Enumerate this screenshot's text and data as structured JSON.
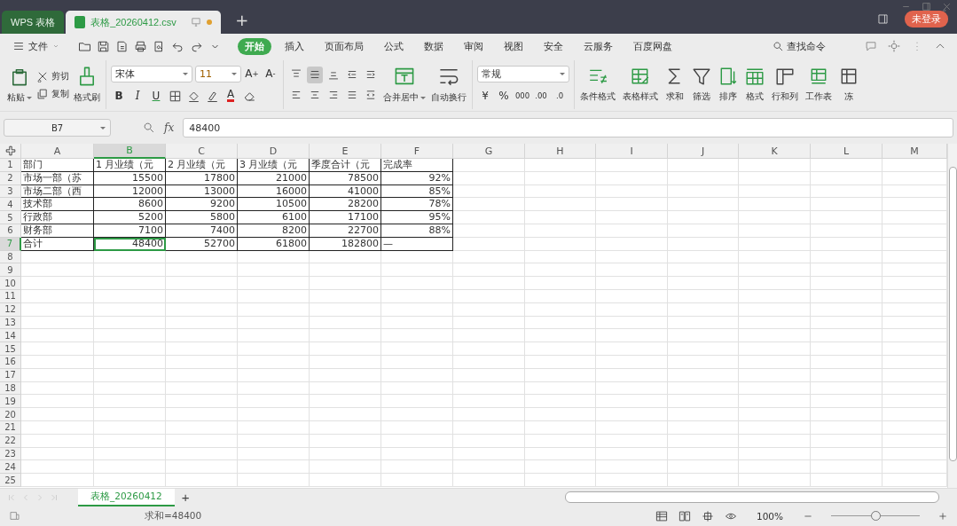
{
  "title_bar": {
    "tabs": [
      {
        "label": "WPS 表格",
        "kind": "home",
        "selected": false,
        "unsaved": false
      },
      {
        "label": "表格_20260412.csv",
        "kind": "file",
        "selected": true,
        "unsaved": true
      }
    ],
    "new_tab": "+",
    "login": "未登录"
  },
  "menu_bar": {
    "file": "文件",
    "tabs": [
      {
        "label": "开始",
        "selected": true
      },
      {
        "label": "插入",
        "selected": false
      },
      {
        "label": "页面布局",
        "selected": false
      },
      {
        "label": "公式",
        "selected": false
      },
      {
        "label": "数据",
        "selected": false
      },
      {
        "label": "审阅",
        "selected": false
      },
      {
        "label": "视图",
        "selected": false
      },
      {
        "label": "安全",
        "selected": false
      },
      {
        "label": "云服务",
        "selected": false
      },
      {
        "label": "百度网盘",
        "selected": false
      }
    ],
    "search": "查找命令"
  },
  "ribbon": {
    "clipboard": {
      "paste": "粘贴",
      "cut": "剪切",
      "copy": "复制",
      "format_painter": "格式刷"
    },
    "font": {
      "family": "宋体",
      "size": "11",
      "grow": "A",
      "grow_mark": "+",
      "shrink": "A",
      "shrink_mark": "-",
      "styles": [
        {
          "kind": "bold",
          "glyph": "B"
        },
        {
          "kind": "italic",
          "glyph": "I"
        },
        {
          "kind": "underline",
          "glyph": "U"
        },
        {
          "kind": "border"
        },
        {
          "kind": "fill"
        },
        {
          "kind": "highlight"
        },
        {
          "kind": "font-color",
          "glyph": "A"
        },
        {
          "kind": "clear"
        }
      ]
    },
    "alignment": {
      "tools": [
        {
          "kind": "top",
          "selected": false
        },
        {
          "kind": "middle",
          "selected": true
        },
        {
          "kind": "bottom",
          "selected": false
        },
        {
          "kind": "outdent",
          "selected": false
        },
        {
          "kind": "indent",
          "selected": false
        },
        {
          "kind": "left",
          "selected": false
        },
        {
          "kind": "center",
          "selected": false
        },
        {
          "kind": "right",
          "selected": false
        },
        {
          "kind": "justify",
          "selected": false
        },
        {
          "kind": "distribute",
          "selected": false
        }
      ],
      "merge": "合并居中",
      "wrap": "自动换行"
    },
    "number": {
      "format": "常规",
      "tools": [
        {
          "kind": "currency",
          "glyph": "¥"
        },
        {
          "kind": "percent",
          "glyph": "%"
        },
        {
          "kind": "thousands",
          "glyph": "000"
        },
        {
          "kind": "add-decimal",
          "glyph": ".00"
        },
        {
          "kind": "remove-decimal",
          "glyph": ".0"
        }
      ]
    },
    "commands": [
      {
        "kind": "conditional",
        "label": "条件格式"
      },
      {
        "kind": "table-style",
        "label": "表格样式"
      },
      {
        "kind": "sum",
        "label": "求和"
      },
      {
        "kind": "filter",
        "label": "筛选"
      },
      {
        "kind": "sort",
        "label": "排序"
      },
      {
        "kind": "format",
        "label": "格式"
      },
      {
        "kind": "rowcol",
        "label": "行和列"
      },
      {
        "kind": "sheet",
        "label": "工作表"
      },
      {
        "kind": "freeze",
        "label": "冻"
      }
    ]
  },
  "formula_bar": {
    "name_box": "B7",
    "fx": "fx",
    "value": "48400"
  },
  "sheet": {
    "columns": [
      {
        "label": "A",
        "selected": false
      },
      {
        "label": "B",
        "selected": true
      },
      {
        "label": "C",
        "selected": false
      },
      {
        "label": "D",
        "selected": false
      },
      {
        "label": "E",
        "selected": false
      },
      {
        "label": "F",
        "selected": false
      },
      {
        "label": "G",
        "selected": false
      },
      {
        "label": "H",
        "selected": false
      },
      {
        "label": "I",
        "selected": false
      },
      {
        "label": "J",
        "selected": false
      },
      {
        "label": "K",
        "selected": false
      },
      {
        "label": "L",
        "selected": false
      },
      {
        "label": "M",
        "selected": false
      }
    ],
    "rows": [
      {
        "label": "1",
        "selected": false,
        "cells": [
          {
            "text": "部门",
            "kind": "text",
            "selected": false
          },
          {
            "text": "1 月业绩（元",
            "kind": "text",
            "selected": false
          },
          {
            "text": "2 月业绩（元",
            "kind": "text",
            "selected": false
          },
          {
            "text": "3 月业绩（元",
            "kind": "text",
            "selected": false
          },
          {
            "text": "季度合计（元",
            "kind": "text",
            "selected": false
          },
          {
            "text": "完成率",
            "kind": "text",
            "selected": false
          }
        ]
      },
      {
        "label": "2",
        "selected": false,
        "cells": [
          {
            "text": "市场一部（苏",
            "kind": "text",
            "selected": false
          },
          {
            "text": "15500",
            "kind": "number",
            "selected": false
          },
          {
            "text": "17800",
            "kind": "number",
            "selected": false
          },
          {
            "text": "21000",
            "kind": "number",
            "selected": false
          },
          {
            "text": "78500",
            "kind": "number",
            "selected": false
          },
          {
            "text": "92%",
            "kind": "number",
            "selected": false
          }
        ]
      },
      {
        "label": "3",
        "selected": false,
        "cells": [
          {
            "text": "市场二部（西",
            "kind": "text",
            "selected": false
          },
          {
            "text": "12000",
            "kind": "number",
            "selected": false
          },
          {
            "text": "13000",
            "kind": "number",
            "selected": false
          },
          {
            "text": "16000",
            "kind": "number",
            "selected": false
          },
          {
            "text": "41000",
            "kind": "number",
            "selected": false
          },
          {
            "text": "85%",
            "kind": "number",
            "selected": false
          }
        ]
      },
      {
        "label": "4",
        "selected": false,
        "cells": [
          {
            "text": "技术部",
            "kind": "text",
            "selected": false
          },
          {
            "text": "8600",
            "kind": "number",
            "selected": false
          },
          {
            "text": "9200",
            "kind": "number",
            "selected": false
          },
          {
            "text": "10500",
            "kind": "number",
            "selected": false
          },
          {
            "text": "28200",
            "kind": "number",
            "selected": false
          },
          {
            "text": "78%",
            "kind": "number",
            "selected": false
          }
        ]
      },
      {
        "label": "5",
        "selected": false,
        "cells": [
          {
            "text": "行政部",
            "kind": "text",
            "selected": false
          },
          {
            "text": "5200",
            "kind": "number",
            "selected": false
          },
          {
            "text": "5800",
            "kind": "number",
            "selected": false
          },
          {
            "text": "6100",
            "kind": "number",
            "selected": false
          },
          {
            "text": "17100",
            "kind": "number",
            "selected": false
          },
          {
            "text": "95%",
            "kind": "number",
            "selected": false
          }
        ]
      },
      {
        "label": "6",
        "selected": false,
        "cells": [
          {
            "text": "财务部",
            "kind": "text",
            "selected": false
          },
          {
            "text": "7100",
            "kind": "number",
            "selected": false
          },
          {
            "text": "7400",
            "kind": "number",
            "selected": false
          },
          {
            "text": "8200",
            "kind": "number",
            "selected": false
          },
          {
            "text": "22700",
            "kind": "number",
            "selected": false
          },
          {
            "text": "88%",
            "kind": "number",
            "selected": false
          }
        ]
      },
      {
        "label": "7",
        "selected": true,
        "cells": [
          {
            "text": "合计",
            "kind": "text",
            "selected": false
          },
          {
            "text": "48400",
            "kind": "number",
            "selected": true
          },
          {
            "text": "52700",
            "kind": "number",
            "selected": false
          },
          {
            "text": "61800",
            "kind": "number",
            "selected": false
          },
          {
            "text": "182800",
            "kind": "number",
            "selected": false
          },
          {
            "text": "—",
            "kind": "text",
            "selected": false
          }
        ]
      },
      {
        "label": "8",
        "selected": false
      },
      {
        "label": "9",
        "selected": false
      },
      {
        "label": "10",
        "selected": false
      },
      {
        "label": "11",
        "selected": false
      },
      {
        "label": "12",
        "selected": false
      },
      {
        "label": "13",
        "selected": false
      },
      {
        "label": "14",
        "selected": false
      },
      {
        "label": "15",
        "selected": false
      },
      {
        "label": "16",
        "selected": false
      },
      {
        "label": "17",
        "selected": false
      },
      {
        "label": "18",
        "selected": false
      },
      {
        "label": "19",
        "selected": false
      },
      {
        "label": "20",
        "selected": false
      },
      {
        "label": "21",
        "selected": false
      },
      {
        "label": "22",
        "selected": false
      },
      {
        "label": "23",
        "selected": false
      },
      {
        "label": "24",
        "selected": false
      },
      {
        "label": "25",
        "selected": false
      }
    ]
  },
  "sheet_tabs": {
    "tabs": [
      {
        "label": "表格_20260412",
        "selected": true
      }
    ],
    "add": "+"
  },
  "status_bar": {
    "summary": "求和=48400",
    "zoom": "100%",
    "zoom_slider": {
      "level": 0.5
    }
  }
}
